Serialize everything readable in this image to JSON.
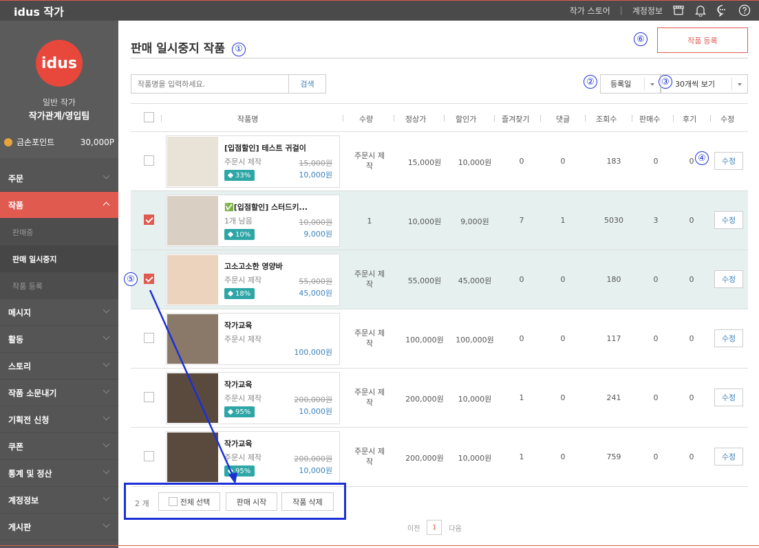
{
  "topbar": {
    "logo": "idus 작가",
    "links": [
      "작가 스토어",
      "계정정보"
    ]
  },
  "sidebar": {
    "logo": "idus",
    "role": "일반 작가",
    "team": "작가관계/영입팀",
    "points_label": "금손포인트",
    "points_value": "30,000P",
    "nav": [
      {
        "label": "주문"
      },
      {
        "label": "작품",
        "active": true
      },
      {
        "label": "판매중",
        "sub": true
      },
      {
        "label": "판매 일시중지",
        "sub": true,
        "current": true
      },
      {
        "label": "작품 등록",
        "sub": true
      },
      {
        "label": "메시지"
      },
      {
        "label": "활동"
      },
      {
        "label": "스토리"
      },
      {
        "label": "작품 소문내기"
      },
      {
        "label": "기획전 신청"
      },
      {
        "label": "쿠폰"
      },
      {
        "label": "통계 및 정산"
      },
      {
        "label": "계정정보"
      },
      {
        "label": "게시판"
      }
    ]
  },
  "main": {
    "title": "판매 일시중지 작품",
    "register_button": "작품 등록",
    "search_placeholder": "작품명을 입력하세요.",
    "search_button": "검색",
    "sort_value": "등록일",
    "per_page_value": "30개씩 보기"
  },
  "annotations": [
    "①",
    "②",
    "③",
    "④",
    "⑤",
    "⑥"
  ],
  "table": {
    "headers": [
      "작품명",
      "수량",
      "정상가",
      "할인가",
      "즐겨찾기",
      "댓글",
      "조회수",
      "판매수",
      "후기",
      "수정"
    ],
    "rows": [
      {
        "name": "[입점할인] 테스트 귀걸이",
        "status": "주문시 제작",
        "old_price": "15,000원",
        "new_price": "10,000원",
        "badge": "33%",
        "qty": "주문시 제작",
        "regular": "15,000원",
        "discount": "10,000원",
        "fav": "0",
        "comments": "0",
        "views": "183",
        "sales": "0",
        "reviews": "0",
        "edit": "수정",
        "checked": false,
        "thumb": "#e9e2d6"
      },
      {
        "name": "✅[입점할인] 스터드키...",
        "status": "1개 남음",
        "old_price": "10,000원",
        "new_price": "9,000원",
        "badge": "10%",
        "qty": "1",
        "regular": "10,000원",
        "discount": "9,000원",
        "fav": "7",
        "comments": "1",
        "views": "5030",
        "sales": "3",
        "reviews": "0",
        "edit": "수정",
        "checked": true,
        "thumb": "#d9cfc2"
      },
      {
        "name": "고소고소한 영양바",
        "status": "주문시 제작",
        "old_price": "55,000원",
        "new_price": "45,000원",
        "badge": "18%",
        "qty": "주문시 제작",
        "regular": "55,000원",
        "discount": "45,000원",
        "fav": "0",
        "comments": "0",
        "views": "180",
        "sales": "0",
        "reviews": "0",
        "edit": "수정",
        "checked": true,
        "thumb": "#ebd3bd"
      },
      {
        "name": "작가교육",
        "status": "주문시 제작",
        "old_price": "",
        "new_price": "100,000원",
        "badge": "",
        "qty": "주문시 제작",
        "regular": "100,000원",
        "discount": "100,000원",
        "fav": "0",
        "comments": "0",
        "views": "117",
        "sales": "0",
        "reviews": "0",
        "edit": "수정",
        "checked": false,
        "thumb": "#8a7968"
      },
      {
        "name": "작가교육",
        "status": "주문시 제작",
        "old_price": "200,000원",
        "new_price": "10,000원",
        "badge": "95%",
        "qty": "주문시 제작",
        "regular": "200,000원",
        "discount": "10,000원",
        "fav": "1",
        "comments": "0",
        "views": "241",
        "sales": "0",
        "reviews": "0",
        "edit": "수정",
        "checked": false,
        "thumb": "#5a4a3e"
      },
      {
        "name": "작가교육",
        "status": "주문시 제작",
        "old_price": "200,000원",
        "new_price": "10,000원",
        "badge": "95%",
        "qty": "주문시 제작",
        "regular": "200,000원",
        "discount": "10,000원",
        "fav": "1",
        "comments": "0",
        "views": "759",
        "sales": "0",
        "reviews": "0",
        "edit": "수정",
        "checked": false,
        "thumb": "#5a4a3e"
      }
    ]
  },
  "footer": {
    "count": "2 개",
    "select_all": "전체 선택",
    "start_sale": "판매 시작",
    "delete": "작품 삭제",
    "prev": "이전",
    "page": "1",
    "next": "다음"
  }
}
